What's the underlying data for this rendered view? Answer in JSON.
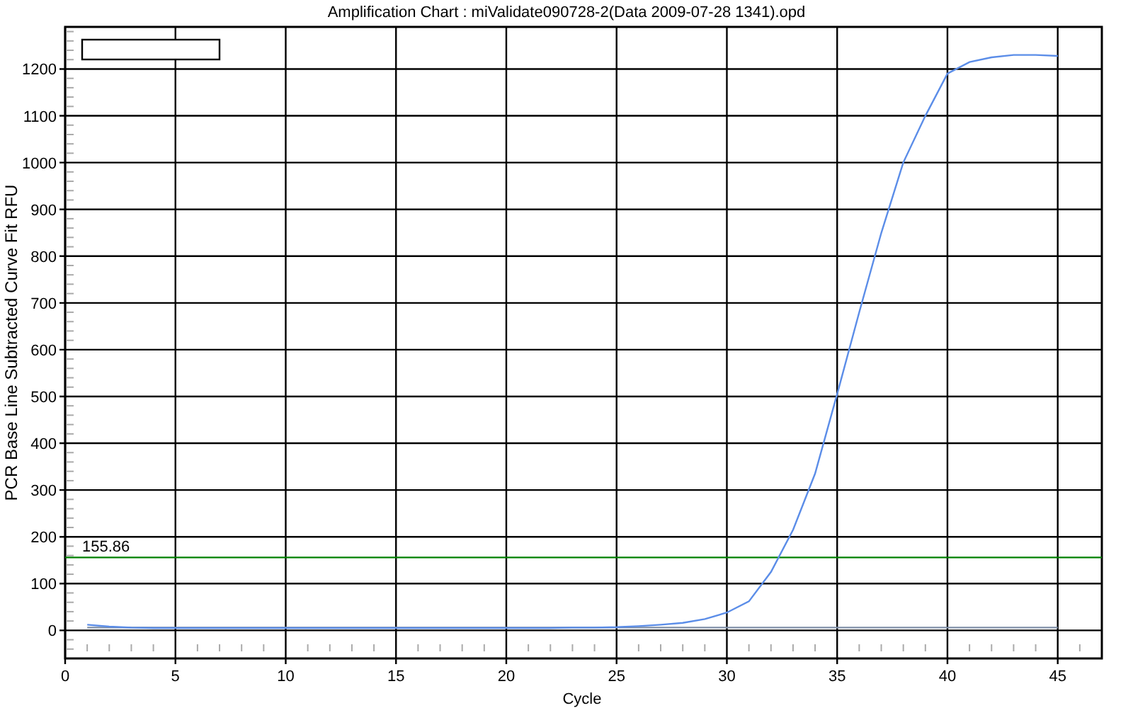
{
  "chart": {
    "chart_data": {
      "type": "line",
      "title": "Amplification Chart : miValidate090728-2(Data 2009-07-28 1341).opd",
      "xlabel": "Cycle",
      "ylabel": "PCR Base Line Subtracted Curve Fit RFU",
      "x": [
        1,
        2,
        3,
        4,
        5,
        6,
        7,
        8,
        9,
        10,
        11,
        12,
        13,
        14,
        15,
        16,
        17,
        18,
        19,
        20,
        21,
        22,
        23,
        24,
        25,
        26,
        27,
        28,
        29,
        30,
        31,
        32,
        33,
        34,
        35,
        36,
        37,
        38,
        39,
        40,
        41,
        42,
        43,
        44,
        45
      ],
      "series": [
        {
          "color": "#5b8de8",
          "values": [
            12,
            8,
            6,
            5,
            5,
            5,
            5,
            5,
            5,
            5,
            5,
            5,
            5,
            5,
            5,
            5,
            5,
            5,
            5,
            5,
            5,
            5,
            6,
            6,
            7,
            9,
            12,
            16,
            24,
            38,
            62,
            125,
            215,
            335,
            505,
            680,
            850,
            1000,
            1100,
            1190,
            1215,
            1225,
            1230,
            1230,
            1228
          ]
        },
        {
          "color": "#8090a8",
          "values": [
            6,
            6,
            6,
            6,
            6,
            6,
            6,
            6,
            6,
            6,
            6,
            6,
            6,
            6,
            6,
            6,
            6,
            6,
            6,
            6,
            6,
            6,
            6,
            6,
            6,
            6,
            6,
            6,
            6,
            6,
            6,
            6,
            6,
            6,
            6,
            6,
            6,
            6,
            6,
            6,
            6,
            6,
            6,
            6,
            6
          ]
        }
      ],
      "xlim": [
        0,
        47
      ],
      "ylim": [
        -60,
        1290
      ],
      "xticks": [
        0,
        5,
        10,
        15,
        20,
        25,
        30,
        35,
        40,
        45
      ],
      "yticks": [
        0,
        100,
        200,
        300,
        400,
        500,
        600,
        700,
        800,
        900,
        1000,
        1100,
        1200
      ],
      "grid": true,
      "ref_lines": [
        {
          "axis": "y",
          "value": 155.86,
          "label": "155.86",
          "color": "#008000"
        }
      ]
    }
  }
}
